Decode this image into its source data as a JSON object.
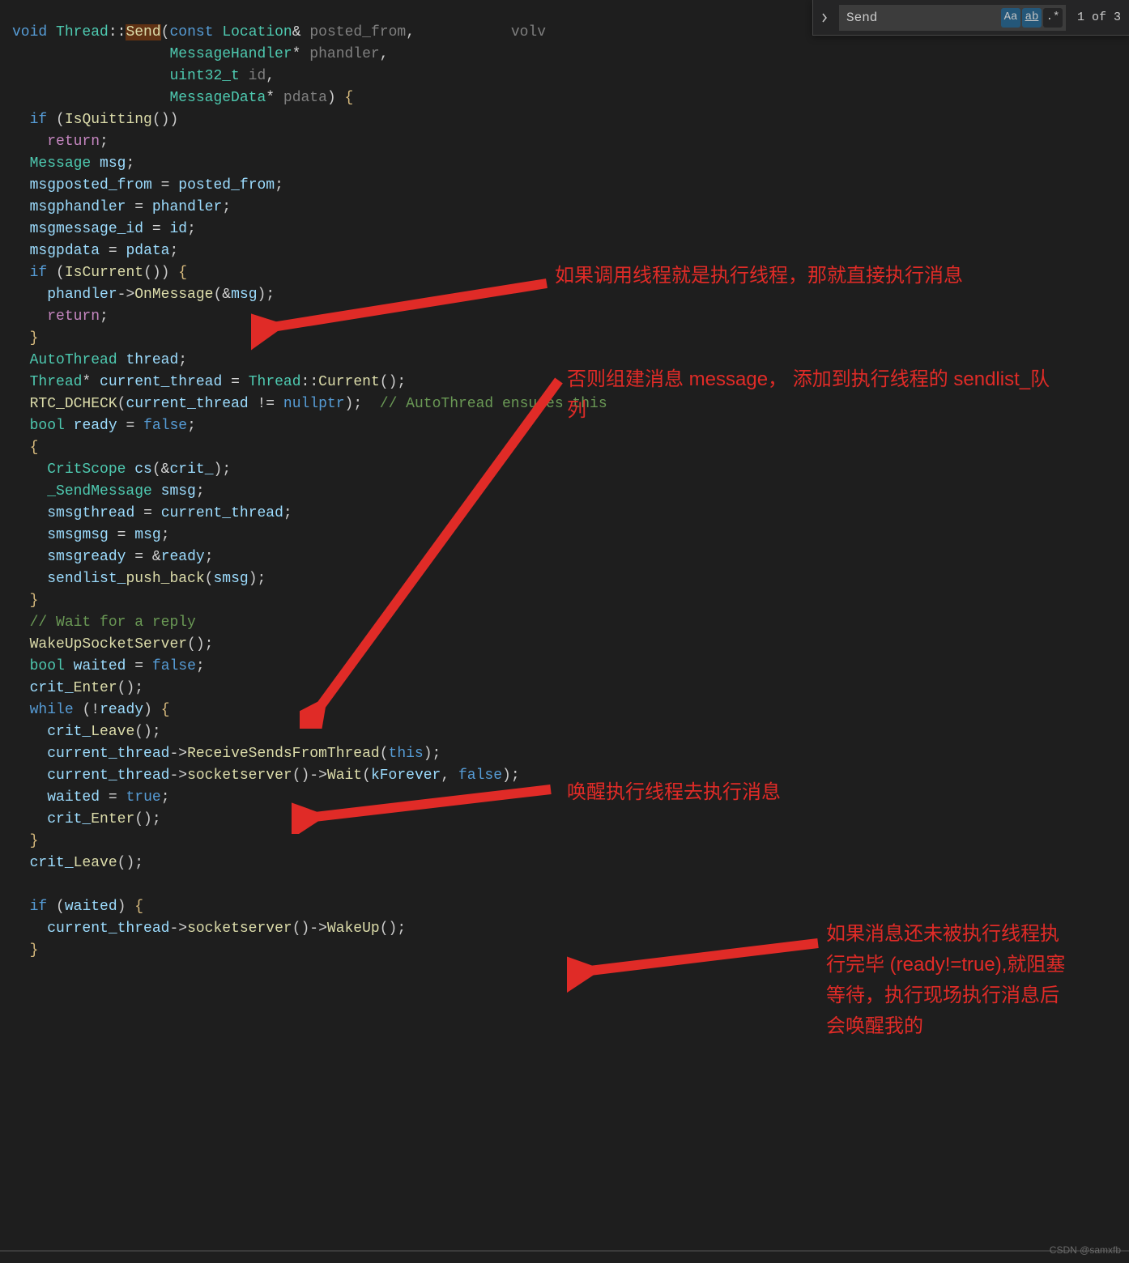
{
  "find": {
    "value": "Send",
    "match_count": "1 of 3",
    "case_icon": "Aa",
    "word_icon": "ab",
    "regex_icon": ".*"
  },
  "annotations": {
    "a1": "如果调用线程就是执行线程，那就直接执行消息",
    "a2": "否则组建消息 message， 添加到执行线程的 sendlist_队列",
    "a3": "唤醒执行线程去执行消息",
    "a4": "如果消息还未被执行线程执行完毕 (ready!=true),就阻塞等待，执行现场执行消息后会唤醒我的"
  },
  "watermark": "CSDN @samxfb",
  "code": {
    "l1": {
      "kw_void": "void",
      "type_thread": "Thread",
      "op": "::",
      "func_send": "Send",
      "p": "(",
      "kw_const": "const",
      "type_loc": "Location",
      "amp": "&",
      "param": "posted_from",
      "c": ",",
      "tail": "volv"
    },
    "l2": {
      "type": "MessageHandler",
      "star": "*",
      "param": "phandler",
      "c": ","
    },
    "l3": {
      "type": "uint32_t",
      "param": "id",
      "c": ","
    },
    "l4": {
      "type": "MessageData",
      "star": "*",
      "param": "pdata",
      "p": ")",
      "b": "{"
    },
    "l5": {
      "kw": "if",
      "p": "(",
      "func": "IsQuitting",
      "pp": "()",
      ")": ")"
    },
    "l6": {
      "kw": "return",
      ";": ";"
    },
    "l7": {
      "type": "Message",
      "var": "msg",
      ";": ";"
    },
    "l8": {
      "var": "msg",
      ".": ".",
      "fld": "posted_from",
      "op": "=",
      "rhs": "posted_from",
      ";": ";"
    },
    "l9": {
      "var": "msg",
      ".": ".",
      "fld": "phandler",
      "op": "=",
      "rhs": "phandler",
      ";": ";"
    },
    "l10": {
      "var": "msg",
      ".": ".",
      "fld": "message_id",
      "op": "=",
      "rhs": "id",
      ";": ";"
    },
    "l11": {
      "var": "msg",
      ".": ".",
      "fld": "pdata",
      "op": "=",
      "rhs": "pdata",
      ";": ";"
    },
    "l12": {
      "kw": "if",
      "p": "(",
      "func": "IsCurrent",
      "pp": "()",
      ")": ")",
      "b": "{"
    },
    "l13": {
      "var": "phandler",
      "op": "->",
      "func": "OnMessage",
      "p": "(",
      "amp": "&",
      "arg": "msg",
      ")": ")",
      ";": ";"
    },
    "l14": {
      "kw": "return",
      ";": ";"
    },
    "l15": {
      "b": "}"
    },
    "l16": {
      "type": "AutoThread",
      "var": "thread",
      ";": ";"
    },
    "l17": {
      "type": "Thread",
      "star": "*",
      "var": "current_thread",
      "op": "=",
      "type2": "Thread",
      "op2": "::",
      "func": "Current",
      "pp": "()",
      ";": ";"
    },
    "l18": {
      "macro": "RTC_DCHECK",
      "p": "(",
      "var": "current_thread",
      "op": "!=",
      "kw": "nullptr",
      ")": ")",
      ";": ";",
      "cmt": "// AutoThread ensures this"
    },
    "l19": {
      "type": "bool",
      "var": "ready",
      "op": "=",
      "kw": "false",
      ";": ";"
    },
    "l20": {
      "b": "{"
    },
    "l21": {
      "type": "CritScope",
      "var": "cs",
      "p": "(",
      "amp": "&",
      "arg": "crit_",
      ")": ")",
      ";": ";"
    },
    "l22": {
      "type": "_SendMessage",
      "var": "smsg",
      ";": ";"
    },
    "l23": {
      "var": "smsg",
      ".": ".",
      "fld": "thread",
      "op": "=",
      "rhs": "current_thread",
      ";": ";"
    },
    "l24": {
      "var": "smsg",
      ".": ".",
      "fld": "msg",
      "op": "=",
      "rhs": "msg",
      ";": ";"
    },
    "l25": {
      "var": "smsg",
      ".": ".",
      "fld": "ready",
      "op": "=",
      "amp": "&",
      "rhs": "ready",
      ";": ";"
    },
    "l26": {
      "var": "sendlist_",
      ".": ".",
      "func": "push_back",
      "p": "(",
      "arg": "smsg",
      ")": ")",
      ";": ";"
    },
    "l27": {
      "b": "}"
    },
    "l28": {
      "cmt": "// Wait for a reply"
    },
    "l29": {
      "func": "WakeUpSocketServer",
      "pp": "()",
      ";": ";"
    },
    "l30": {
      "type": "bool",
      "var": "waited",
      "op": "=",
      "kw": "false",
      ";": ";"
    },
    "l31": {
      "var": "crit_",
      ".": ".",
      "func": "Enter",
      "pp": "()",
      ";": ";"
    },
    "l32": {
      "kw": "while",
      "p": "(",
      "op": "!",
      "var": "ready",
      ")": ")",
      "b": "{"
    },
    "l33": {
      "var": "crit_",
      ".": ".",
      "func": "Leave",
      "pp": "()",
      ";": ";"
    },
    "l34": {
      "var": "current_thread",
      "op": "->",
      "func": "ReceiveSendsFromThread",
      "p": "(",
      "kw": "this",
      ")": ")",
      ";": ";"
    },
    "l35": {
      "var": "current_thread",
      "op": "->",
      "func": "socketserver",
      "pp": "()",
      "op2": "->",
      "func2": "Wait",
      "p": "(",
      "arg": "kForever",
      "c": ",",
      "kw": "false",
      ")": ")",
      ";": ";"
    },
    "l36": {
      "var": "waited",
      "op": "=",
      "kw": "true",
      ";": ";"
    },
    "l37": {
      "var": "crit_",
      ".": ".",
      "func": "Enter",
      "pp": "()",
      ";": ";"
    },
    "l38": {
      "b": "}"
    },
    "l39": {
      "var": "crit_",
      ".": ".",
      "func": "Leave",
      "pp": "()",
      ";": ";"
    },
    "l40": {
      "": ""
    },
    "l41": {
      "kw": "if",
      "p": "(",
      "var": "waited",
      ")": ")",
      "b": "{"
    },
    "l42": {
      "var": "current_thread",
      "op": "->",
      "func": "socketserver",
      "pp": "()",
      "op2": "->",
      "func2": "WakeUp",
      "pp2": "()",
      ";": ";"
    },
    "l43": {
      "b": "}"
    }
  }
}
